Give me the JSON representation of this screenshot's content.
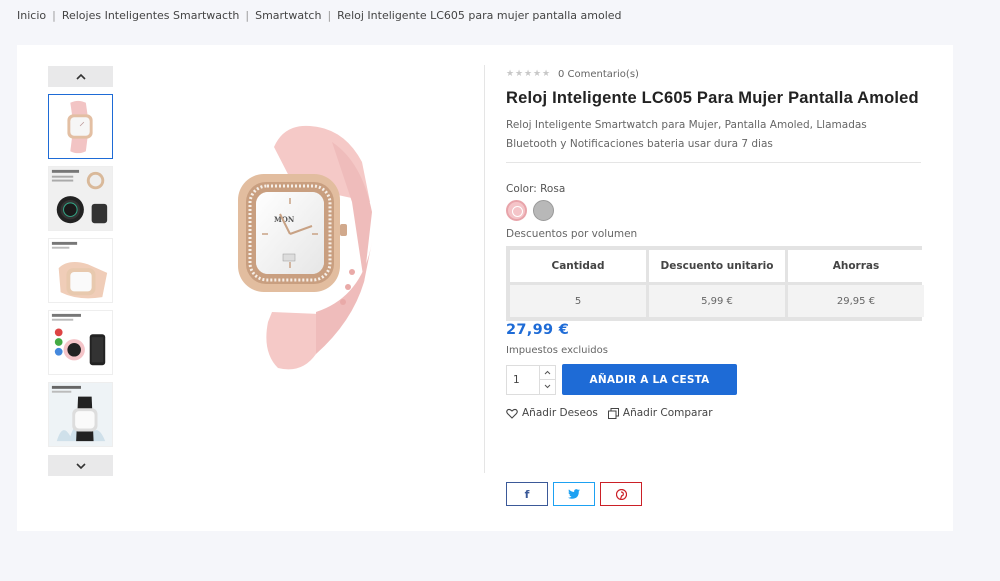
{
  "breadcrumb": {
    "items": [
      "Inicio",
      "Relojes Inteligentes Smartwacth",
      "Smartwatch",
      "Reloj Inteligente LC605 para mujer pantalla amoled"
    ],
    "separator": "|"
  },
  "gallery": {
    "up_icon": "chevron-up-icon",
    "down_icon": "chevron-down-icon",
    "thumbs": [
      {
        "label": "",
        "alt": "pink-watch"
      },
      {
        "label": "Smartwatch features",
        "alt": "black-watch-promo"
      },
      {
        "label": "1.4\" AMOLED screen",
        "alt": "pink-watch-closeup"
      },
      {
        "label": "Bluetooth calls",
        "alt": "watch-phone-promo"
      },
      {
        "label": "Waterproof",
        "alt": "black-watch-splash"
      }
    ],
    "active_index": 0
  },
  "product": {
    "rating_count_label": "0 Comentario(s)",
    "stars": 5,
    "rating": 0,
    "title": "Reloj Inteligente LC605 Para Mujer Pantalla Amoled",
    "description": "Reloj Inteligente Smartwatch para Mujer, Pantalla Amoled, Llamadas Bluetooth y Notificaciones bateria usar dura 7 dias",
    "color_label": "Color: Rosa",
    "colors": [
      {
        "name": "Rosa",
        "hex": "#f4c4c8",
        "selected": true
      },
      {
        "name": "Gris",
        "hex": "#b8b8b8",
        "selected": false
      }
    ],
    "volume_label": "Descuentos por volumen",
    "volume_table": {
      "headers": [
        "Cantidad",
        "Descuento unitario",
        "Ahorras"
      ],
      "rows": [
        [
          "5",
          "5,99 €",
          "29,95 €"
        ]
      ]
    },
    "price": "27,99 €",
    "tax_label": "Impuestos excluidos",
    "quantity": "1",
    "add_to_cart": "AÑADIR A LA CESTA",
    "wishlist": "Añadir Deseos",
    "compare": "Añadir Comparar"
  },
  "share": {
    "facebook": "f",
    "twitter": "t",
    "pinterest": "p"
  },
  "colors": {
    "accent": "#1e6bd6",
    "facebook": "#3b5998",
    "twitter": "#1da1f2",
    "pinterest": "#cb2027"
  }
}
